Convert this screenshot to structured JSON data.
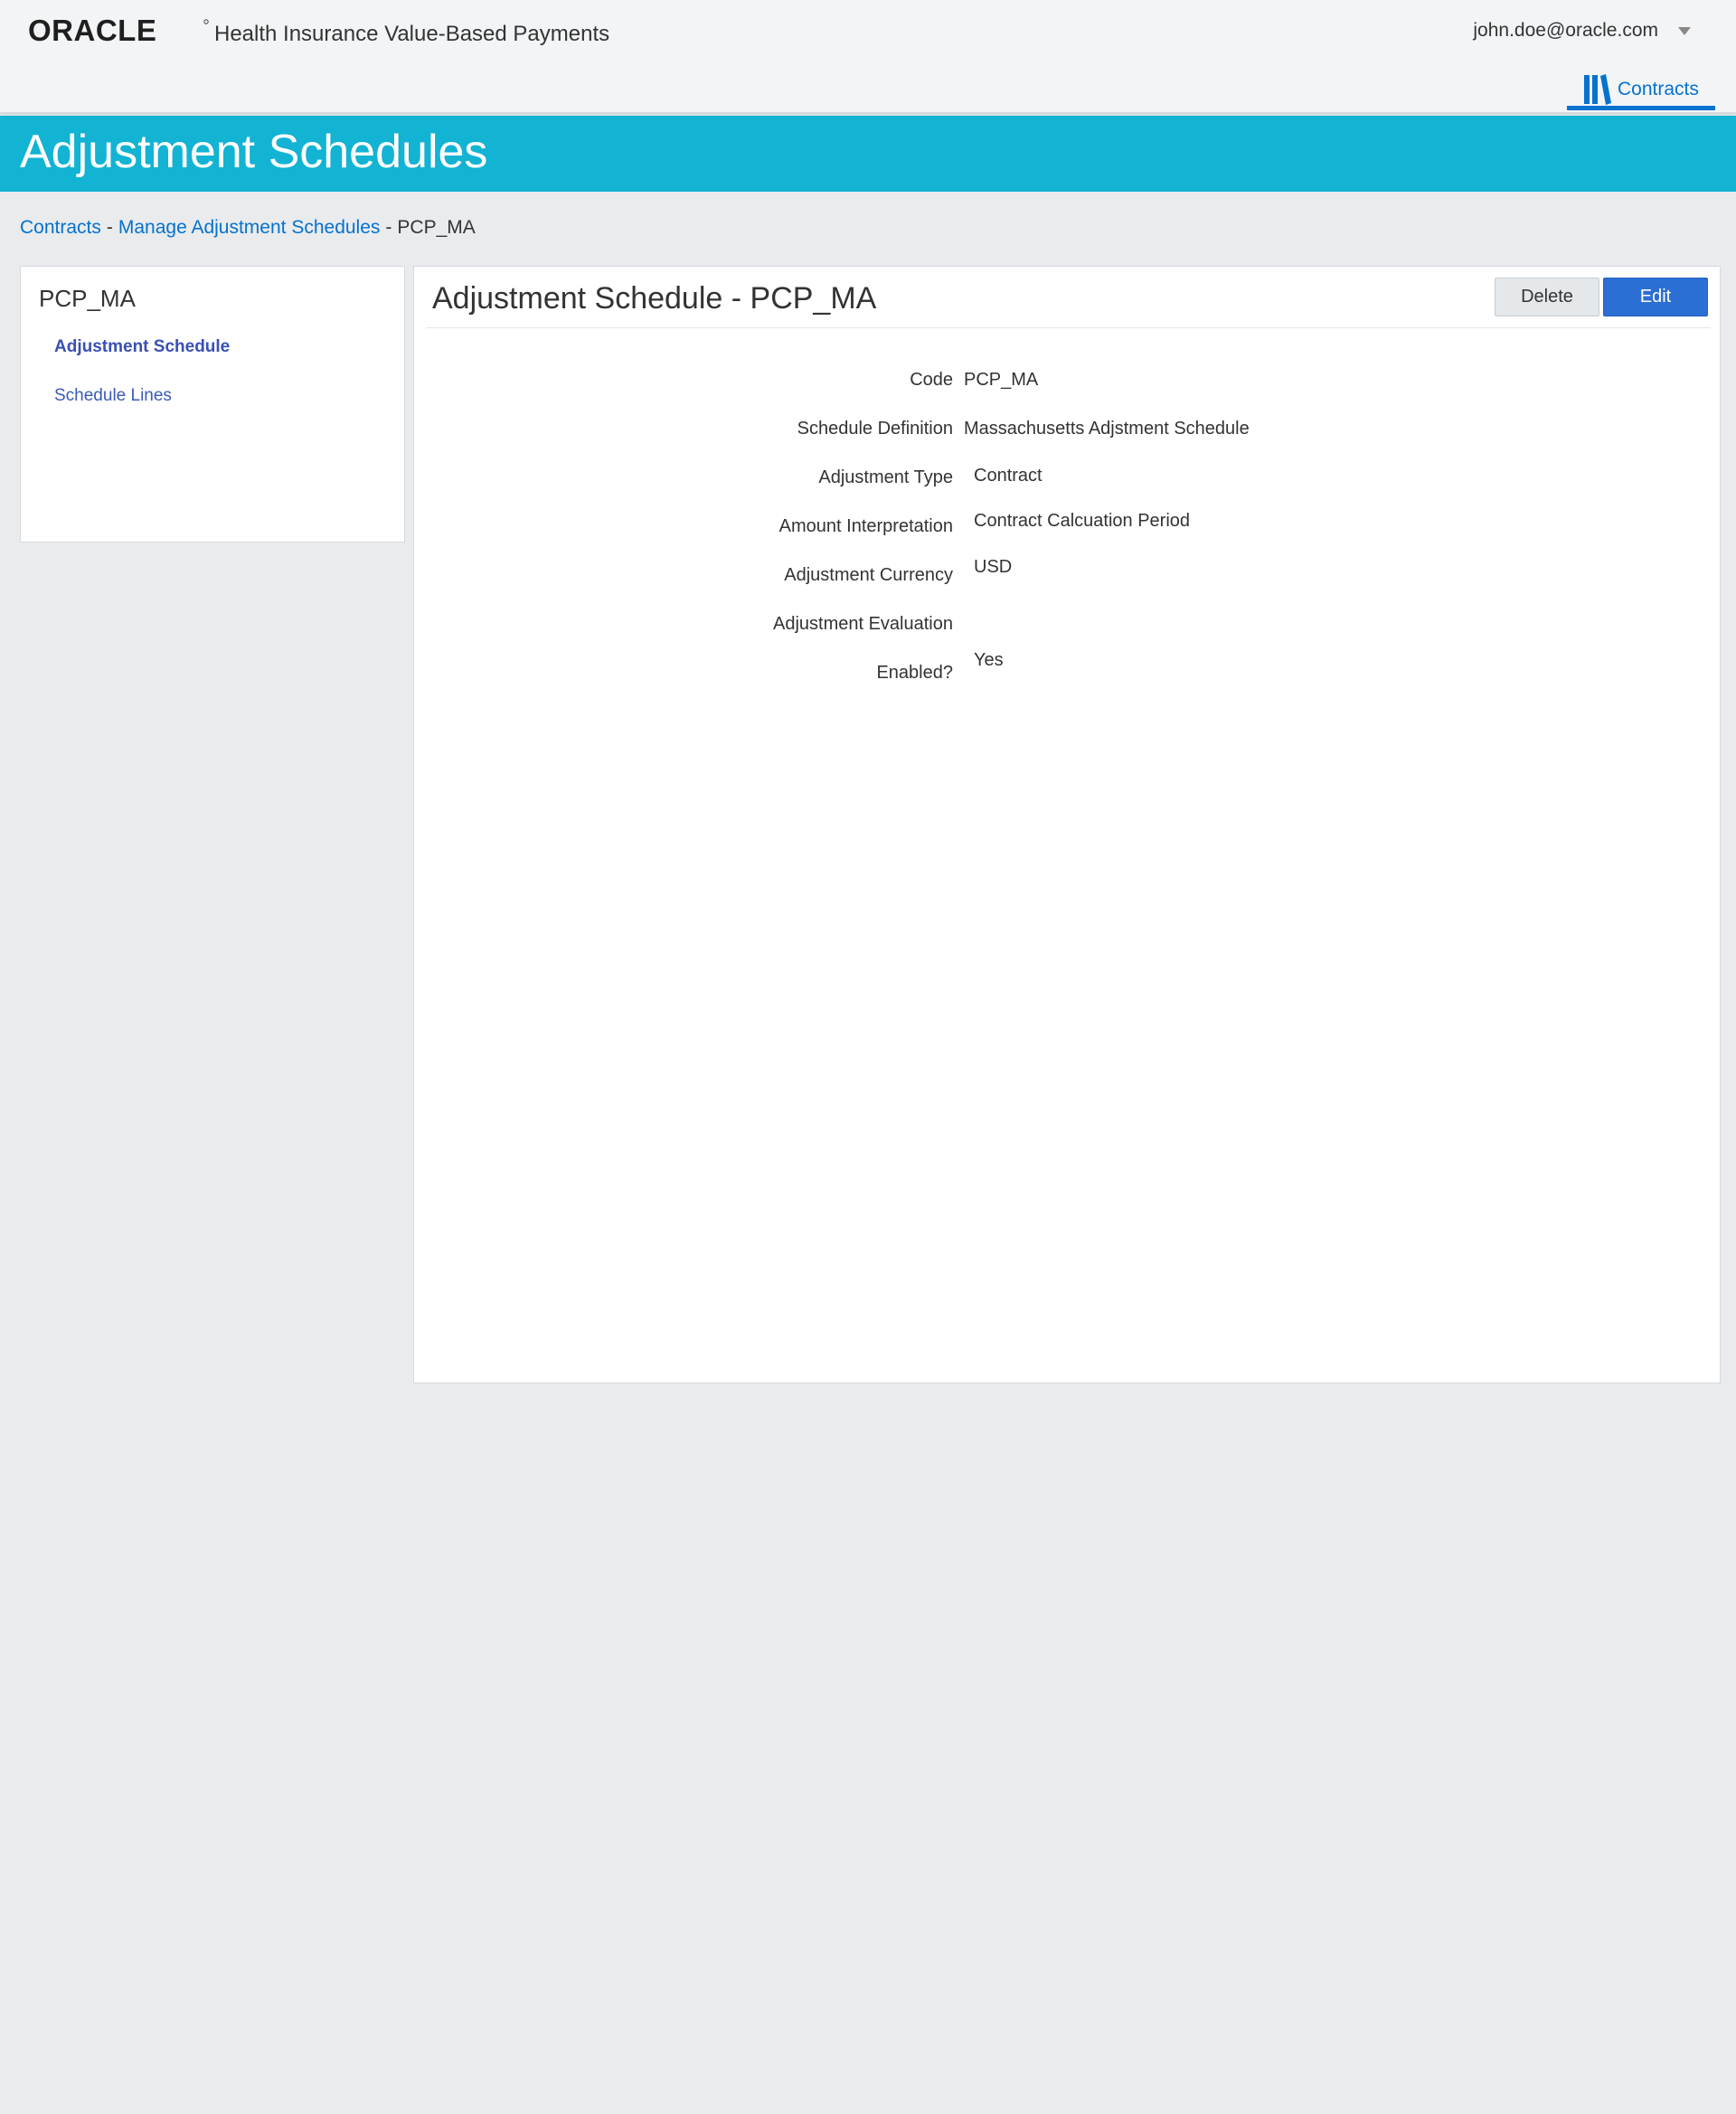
{
  "header": {
    "brand_logo_text": "ORACLE",
    "product_name": "Health Insurance Value-Based Payments",
    "user_email": "john.doe@oracle.com",
    "nav_tab_label": "Contracts"
  },
  "page": {
    "title": "Adjustment Schedules"
  },
  "breadcrumb": {
    "items": [
      "Contracts",
      "Manage Adjustment Schedules"
    ],
    "separator": "-",
    "current": "PCP_MA"
  },
  "left_panel": {
    "title": "PCP_MA",
    "items": [
      {
        "label": "Adjustment Schedule",
        "active": true
      },
      {
        "label": "Schedule Lines",
        "active": false
      }
    ]
  },
  "main_panel": {
    "title": "Adjustment Schedule - PCP_MA",
    "delete_label": "Delete",
    "edit_label": "Edit",
    "fields": [
      {
        "label": "Code",
        "value": "PCP_MA"
      },
      {
        "label": "Schedule Definition",
        "value": "Massachusetts Adjstment Schedule"
      },
      {
        "label": "Adjustment Type",
        "value": "Contract"
      },
      {
        "label": "Amount Interpretation",
        "value": "Contract Calcuation Period"
      },
      {
        "label": "Adjustment Currency",
        "value": "USD"
      },
      {
        "label": "Adjustment Evaluation",
        "value": ""
      },
      {
        "label": "Enabled?",
        "value": "Yes"
      }
    ]
  },
  "colors": {
    "title_band": "#12b3d3",
    "link": "#0572ce",
    "primary_button": "#2b6ed4"
  }
}
